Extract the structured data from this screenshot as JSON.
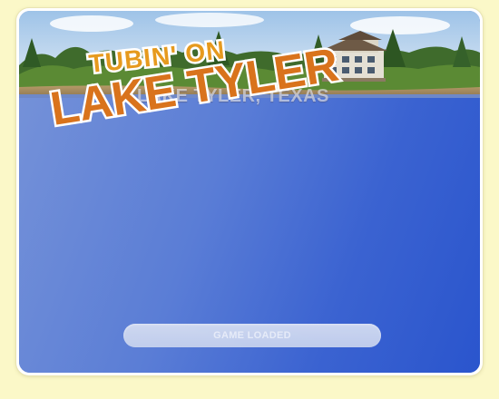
{
  "game": {
    "title_line1": "TUBIN' ON",
    "title_line2": "LAKE TYLER",
    "subtitle": "LAKE TYLER, TEXAS",
    "status_label": "GAME LOADED"
  },
  "colors": {
    "page_background": "#fbf8c8",
    "water": "#3a62d0",
    "title_fill": "#d9771e",
    "title_outline": "#ffffff",
    "loading_bar": "#d3dcf2"
  }
}
